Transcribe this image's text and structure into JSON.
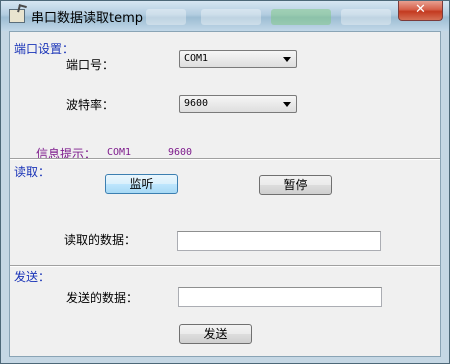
{
  "window": {
    "title": "串口数据读取temp",
    "close_label": "✕"
  },
  "port_settings": {
    "group_label": "端口设置：",
    "port_label": "端口号：",
    "port_value": "COM1",
    "baud_label": "波特率：",
    "baud_value": "9600",
    "info_label": "信息提示：",
    "info_port": "COM1",
    "info_baud": "9600"
  },
  "read": {
    "group_label": "读取：",
    "listen_button": "监听",
    "pause_button": "暂停",
    "data_label": "读取的数据：",
    "data_value": ""
  },
  "send": {
    "group_label": "发送：",
    "data_label": "发送的数据：",
    "data_value": "",
    "send_button": "发送"
  },
  "colors": {
    "group_label": "#1a34b8",
    "info_text": "#7d1a8c"
  }
}
